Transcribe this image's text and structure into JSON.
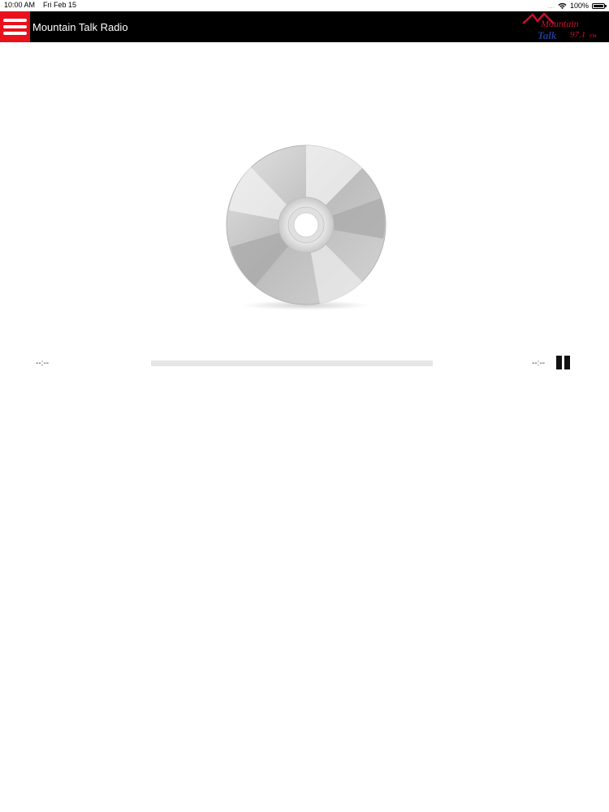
{
  "status_bar": {
    "time": "10:00 AM",
    "date": "Fri Feb 15",
    "signal": "....",
    "wifi_icon": "wifi-icon",
    "battery": "100%",
    "battery_icon": "battery-icon"
  },
  "nav": {
    "menu_icon": "hamburger-menu-icon",
    "title": "Mountain Talk Radio",
    "logo": {
      "line1": "Mountain",
      "line2": "Talk",
      "freq": "97.1",
      "band": "FM"
    }
  },
  "player": {
    "album_art_icon": "cd-disc-icon",
    "time_elapsed": "--:--",
    "time_remaining": "--:--",
    "progress": 0,
    "pause_icon": "pause-icon"
  },
  "colors": {
    "menu_accent": "#e8111c",
    "nav_background": "#000000",
    "logo_red": "#c8102e",
    "logo_blue": "#1f3c8f"
  }
}
